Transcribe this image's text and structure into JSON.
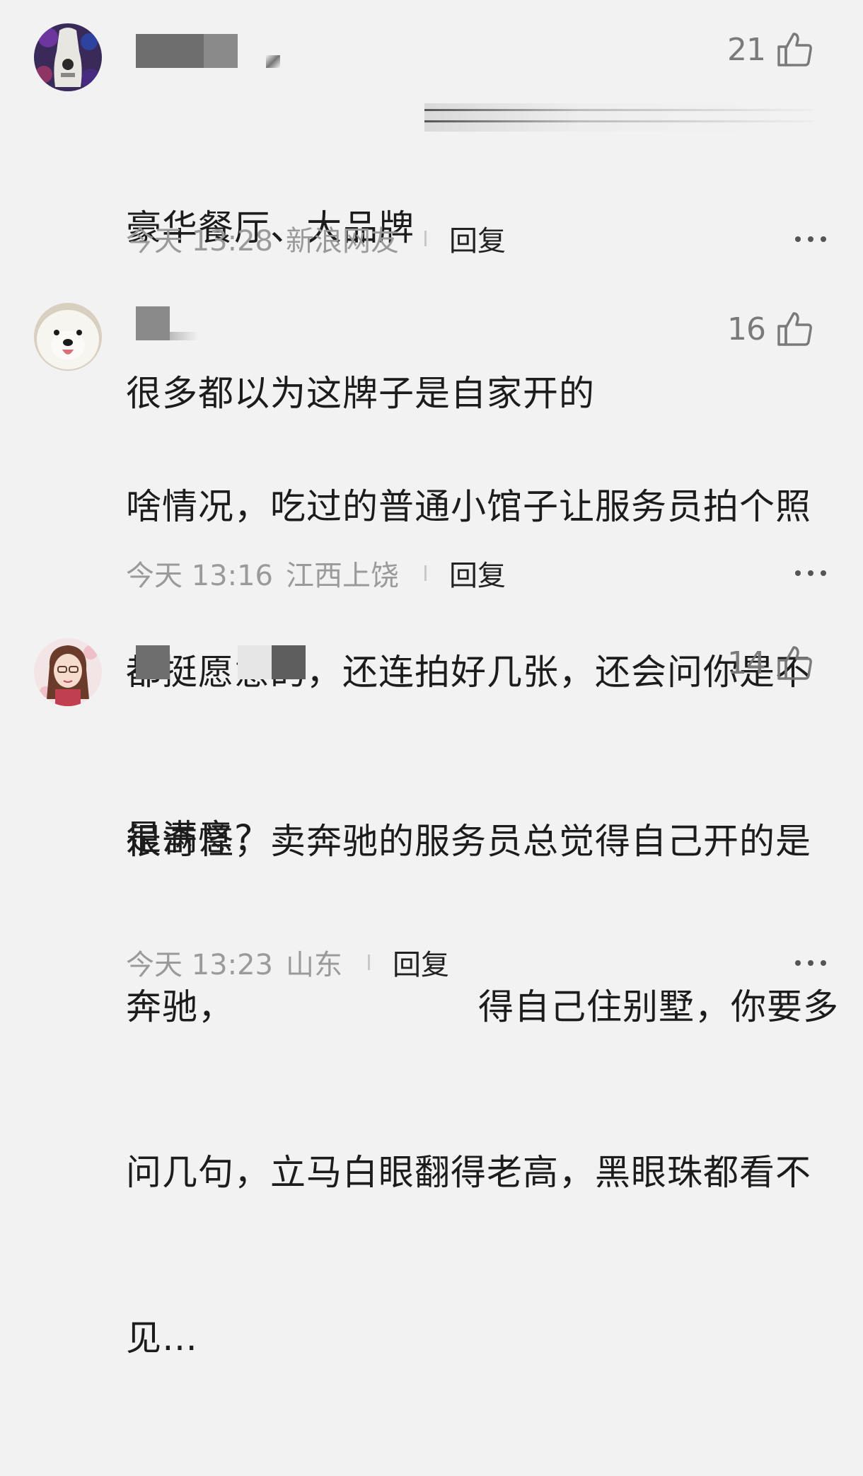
{
  "comments": [
    {
      "likes": "21",
      "lines": [
        "豪华餐厅、大品牌",
        "很多都以为这牌子是自家开的"
      ],
      "time": "今天 13:28",
      "location": "新浪网友",
      "reply": "回复"
    },
    {
      "likes": "16",
      "lines": [
        "啥情况，吃过的普通小馆子让服务员拍个照",
        "都挺愿意的，还连拍好几张，还会问你是不",
        "是满意?"
      ],
      "time": "今天 13:16",
      "location": "江西上饶",
      "reply": "回复"
    },
    {
      "likes": "14",
      "lines": [
        "很奇怪，卖奔驰的服务员总觉得自己开的是",
        "奔驰，",
        "得自己住别墅，你要多",
        "问几句，立马白眼翻得老高，黑眼珠都看不",
        "见…"
      ],
      "time": "今天 13:23",
      "location": "山东",
      "reply": "回复"
    }
  ],
  "colors": {
    "background": "#f2f2f2",
    "text": "#1c1c1c",
    "meta": "#9a9a9a",
    "likes": "#7a7a7a"
  },
  "icons": [
    "thumbs-up-icon",
    "more-dots-icon"
  ]
}
